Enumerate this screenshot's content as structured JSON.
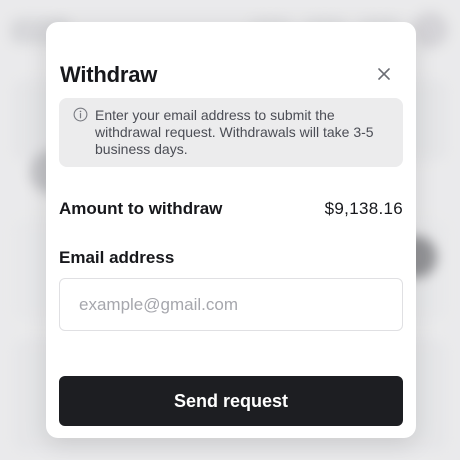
{
  "modal": {
    "title": "Withdraw",
    "notice": "Enter your email address to submit the withdrawal request. Withdrawals will take 3-5 business days.",
    "amount_label": "Amount to withdraw",
    "amount_value": "$9,138.16",
    "email_label": "Email address",
    "email_value": "",
    "email_placeholder": "example@gmail.com",
    "submit_label": "Send request"
  },
  "icons": {
    "close": "close-icon",
    "info": "info-icon"
  },
  "colors": {
    "button_bg": "#1d1e22",
    "notice_bg": "#ececed",
    "text": "#17181c",
    "backdrop": "#e9e9ea"
  }
}
